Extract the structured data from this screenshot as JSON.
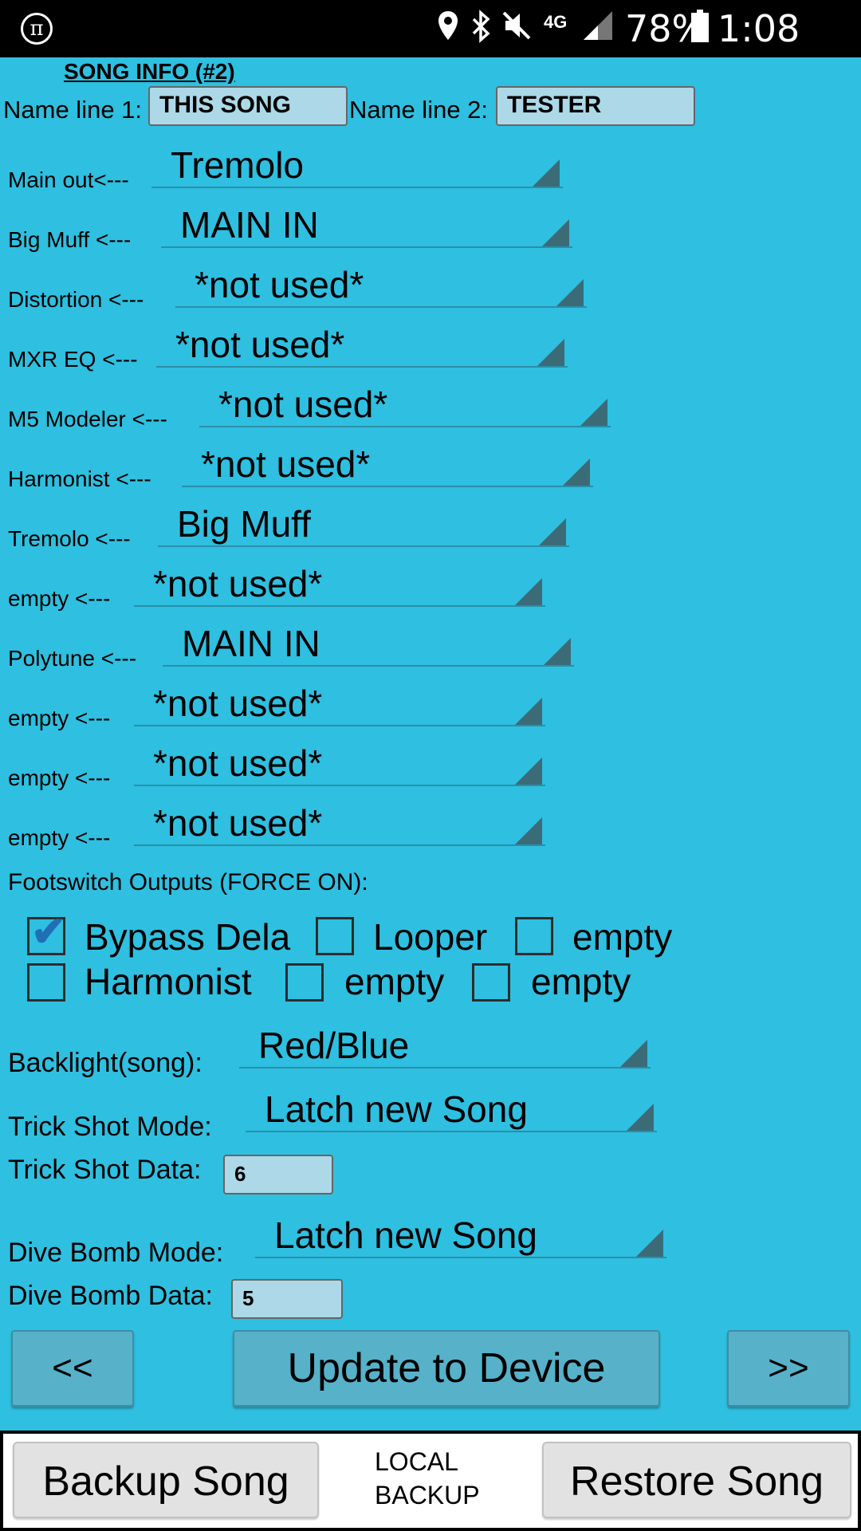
{
  "status": {
    "battery": "78%",
    "time": "1:08 PM",
    "network": "4G"
  },
  "song": {
    "title": "SONG INFO (#2)",
    "name1_label": "Name line 1:",
    "name1_value": "THIS SONG",
    "name2_label": "Name line 2:",
    "name2_value": "TESTER"
  },
  "routing": [
    {
      "label": "Main out<---",
      "value": "Tremolo"
    },
    {
      "label": "Big Muff <---",
      "value": "MAIN IN"
    },
    {
      "label": "Distortion <---",
      "value": "*not used*"
    },
    {
      "label": "MXR EQ <---",
      "value": "*not used*"
    },
    {
      "label": "M5 Modeler <---",
      "value": "*not used*"
    },
    {
      "label": "Harmonist <---",
      "value": "*not used*"
    },
    {
      "label": "Tremolo <---",
      "value": "Big Muff"
    },
    {
      "label": "empty <---",
      "value": "*not used*"
    },
    {
      "label": "Polytune <---",
      "value": "MAIN IN"
    },
    {
      "label": "empty <---",
      "value": "*not used*"
    },
    {
      "label": "empty <---",
      "value": "*not used*"
    },
    {
      "label": "empty <---",
      "value": "*not used*"
    }
  ],
  "footswitch": {
    "title": "Footswitch Outputs (FORCE ON):",
    "items": [
      {
        "label": "Bypass Dela",
        "checked": true
      },
      {
        "label": "Looper",
        "checked": false
      },
      {
        "label": "empty",
        "checked": false
      },
      {
        "label": "Harmonist",
        "checked": false
      },
      {
        "label": "empty",
        "checked": false
      },
      {
        "label": "empty",
        "checked": false
      }
    ]
  },
  "settings": {
    "backlight_label": "Backlight(song):",
    "backlight_value": "Red/Blue",
    "trick_mode_label": "Trick Shot Mode:",
    "trick_mode_value": "Latch new Song",
    "trick_data_label": "Trick Shot Data:",
    "trick_data_value": "6",
    "dive_mode_label": "Dive Bomb Mode:",
    "dive_mode_value": "Latch new Song",
    "dive_data_label": "Dive Bomb Data:",
    "dive_data_value": "5"
  },
  "nav": {
    "prev": "<<",
    "update": "Update to Device",
    "next": ">>"
  },
  "bottom": {
    "backup": "Backup Song",
    "local_line1": "LOCAL",
    "local_line2": "BACKUP",
    "restore": "Restore Song"
  },
  "colors": {
    "background": "#2fbfe0",
    "textbox": "#acd8e7",
    "button": "#56b1c9",
    "dropdown_arrow": "#3c6b78"
  }
}
